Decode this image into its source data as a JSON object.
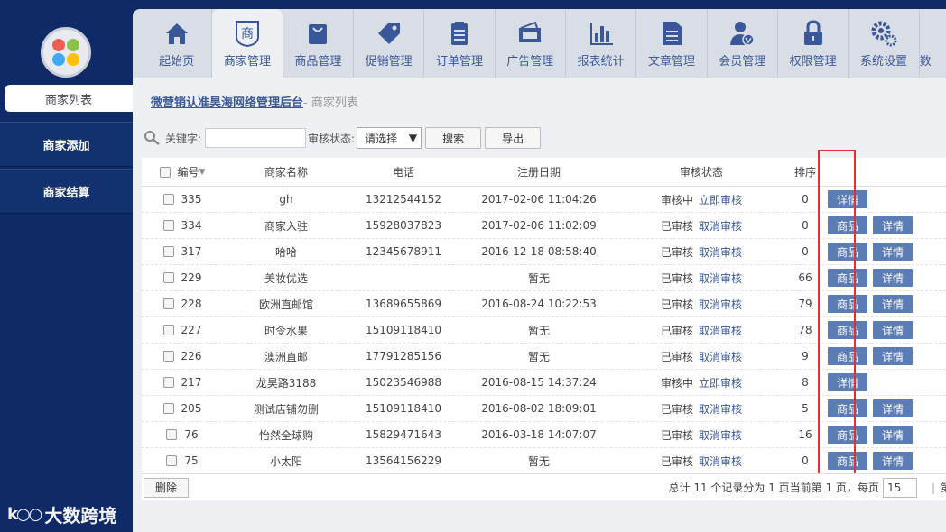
{
  "sidebar": {
    "items": [
      {
        "label": "商家列表"
      },
      {
        "label": "商家添加"
      },
      {
        "label": "商家结算"
      }
    ],
    "watermark": "大数跨境"
  },
  "nav": {
    "tabs": [
      {
        "label": "起始页",
        "icon": "home-icon"
      },
      {
        "label": "商家管理",
        "icon": "shop-icon"
      },
      {
        "label": "商品管理",
        "icon": "bag-icon"
      },
      {
        "label": "促销管理",
        "icon": "tag-icon"
      },
      {
        "label": "订单管理",
        "icon": "clipboard-icon"
      },
      {
        "label": "广告管理",
        "icon": "card-icon"
      },
      {
        "label": "报表统计",
        "icon": "bar-chart-icon"
      },
      {
        "label": "文章管理",
        "icon": "document-icon"
      },
      {
        "label": "会员管理",
        "icon": "user-icon"
      },
      {
        "label": "权限管理",
        "icon": "lock-icon"
      },
      {
        "label": "系统设置",
        "icon": "gear-icon"
      }
    ],
    "cut_label": "数"
  },
  "breadcrumb": {
    "root": "微营销认准昊海网络管理后台",
    "sep": "- ",
    "current": "商家列表"
  },
  "search": {
    "keyword_label": "关键字:",
    "keyword_value": "",
    "status_label": "审核状态:",
    "status_selected": "请选择",
    "search_btn": "搜索",
    "export_btn": "导出"
  },
  "table": {
    "headers": {
      "id": "编号",
      "name": "商家名称",
      "phone": "电话",
      "date": "注册日期",
      "status": "审核状态",
      "sort": "排序"
    },
    "rows": [
      {
        "id": "335",
        "name": "gh",
        "phone": "13212544152",
        "date": "2017-02-06 11:04:26",
        "status": "审核中",
        "action": "立即审核",
        "sort": "0",
        "buttons": [
          "详情"
        ]
      },
      {
        "id": "334",
        "name": "商家入驻",
        "phone": "15928037823",
        "date": "2017-02-06 11:02:09",
        "status": "已审核",
        "action": "取消审核",
        "sort": "0",
        "buttons": [
          "商品",
          "详情"
        ]
      },
      {
        "id": "317",
        "name": "哈哈",
        "phone": "12345678911",
        "date": "2016-12-18 08:58:40",
        "status": "已审核",
        "action": "取消审核",
        "sort": "0",
        "buttons": [
          "商品",
          "详情"
        ]
      },
      {
        "id": "229",
        "name": "美妆优选",
        "phone": "",
        "date": "暂无",
        "status": "已审核",
        "action": "取消审核",
        "sort": "66",
        "buttons": [
          "商品",
          "详情"
        ]
      },
      {
        "id": "228",
        "name": "欧洲直邮馆",
        "phone": "13689655869",
        "date": "2016-08-24 10:22:53",
        "status": "已审核",
        "action": "取消审核",
        "sort": "79",
        "buttons": [
          "商品",
          "详情"
        ]
      },
      {
        "id": "227",
        "name": "时令水果",
        "phone": "15109118410",
        "date": "暂无",
        "status": "已审核",
        "action": "取消审核",
        "sort": "78",
        "buttons": [
          "商品",
          "详情"
        ]
      },
      {
        "id": "226",
        "name": "澳洲直邮",
        "phone": "17791285156",
        "date": "暂无",
        "status": "已审核",
        "action": "取消审核",
        "sort": "9",
        "buttons": [
          "商品",
          "详情"
        ]
      },
      {
        "id": "217",
        "name": "龙昊路3188",
        "phone": "15023546988",
        "date": "2016-08-15 14:37:24",
        "status": "审核中",
        "action": "立即审核",
        "sort": "8",
        "buttons": [
          "详情"
        ]
      },
      {
        "id": "205",
        "name": "测试店铺勿删",
        "phone": "15109118410",
        "date": "2016-08-02 18:09:01",
        "status": "已审核",
        "action": "取消审核",
        "sort": "5",
        "buttons": [
          "商品",
          "详情"
        ]
      },
      {
        "id": "76",
        "name": "怡然全球购",
        "phone": "15829471643",
        "date": "2016-03-18 14:07:07",
        "status": "已审核",
        "action": "取消审核",
        "sort": "16",
        "buttons": [
          "商品",
          "详情"
        ]
      },
      {
        "id": "75",
        "name": "小太阳",
        "phone": "13564156229",
        "date": "暂无",
        "status": "已审核",
        "action": "取消审核",
        "sort": "0",
        "buttons": [
          "商品",
          "详情"
        ]
      }
    ]
  },
  "footer": {
    "delete_btn": "删除",
    "pager_text": "总计 11 个记录分为 1 页当前第 1 页，每页",
    "page_size": "15",
    "cut_text": "第"
  },
  "colors": {
    "sidebar_bg": "#0f2a66",
    "accent": "#3a5899",
    "button_blue": "#5b7cb4",
    "highlight_red": "#e03232"
  }
}
